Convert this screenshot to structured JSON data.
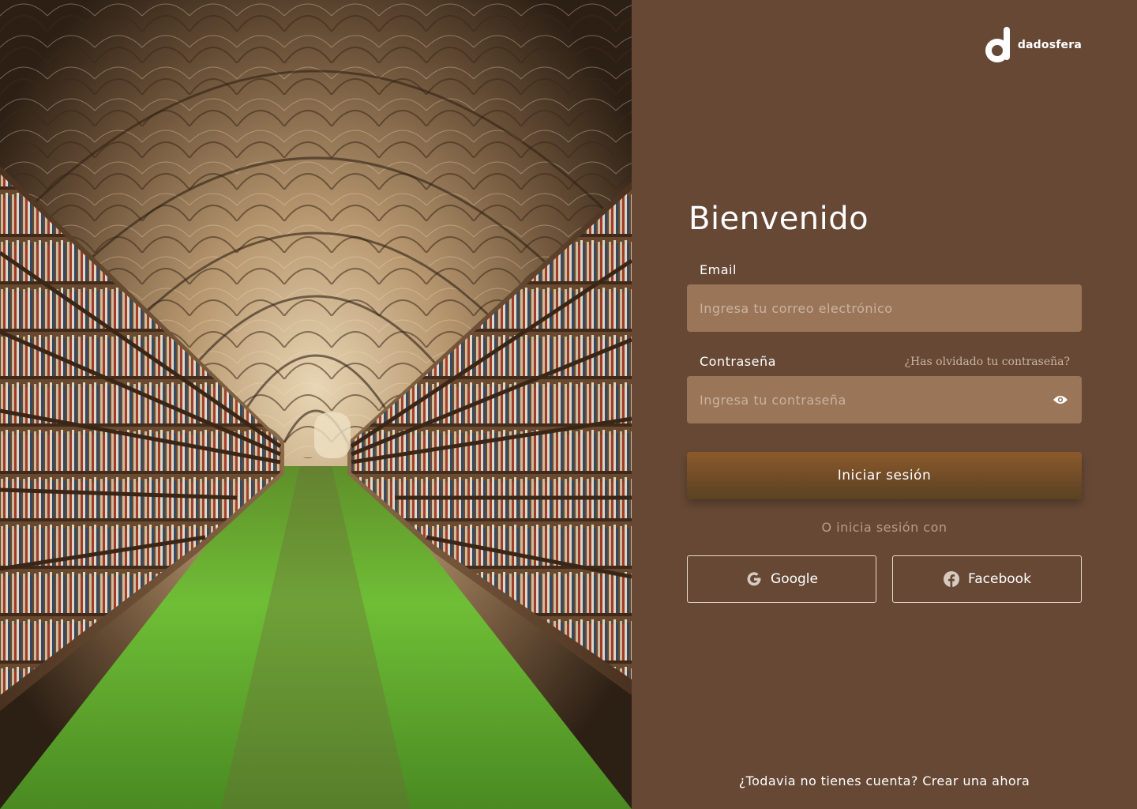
{
  "brand": {
    "name": "dadosfera"
  },
  "hero": {
    "image_description_icon": "library-corridor-image"
  },
  "login": {
    "title": "Bienvenido",
    "email_label": "Email",
    "email_placeholder": "Ingresa tu correo electrónico",
    "password_label": "Contraseña",
    "password_placeholder": "Ingresa tu contraseña",
    "forgot_password": "¿Has olvidado tu contraseña?",
    "submit_label": "Iniciar sesión",
    "alt_login_text": "O inicia sesión con",
    "google_label": "Google",
    "facebook_label": "Facebook",
    "signup_prompt": "¿Todavia no tienes cuenta?",
    "signup_link": "Crear una ahora"
  },
  "colors": {
    "panel_bg": "#664835",
    "field_bg": "#9a7558",
    "button_top": "#8b5a2b",
    "button_bottom": "#5a4322",
    "text": "#ffffff"
  }
}
